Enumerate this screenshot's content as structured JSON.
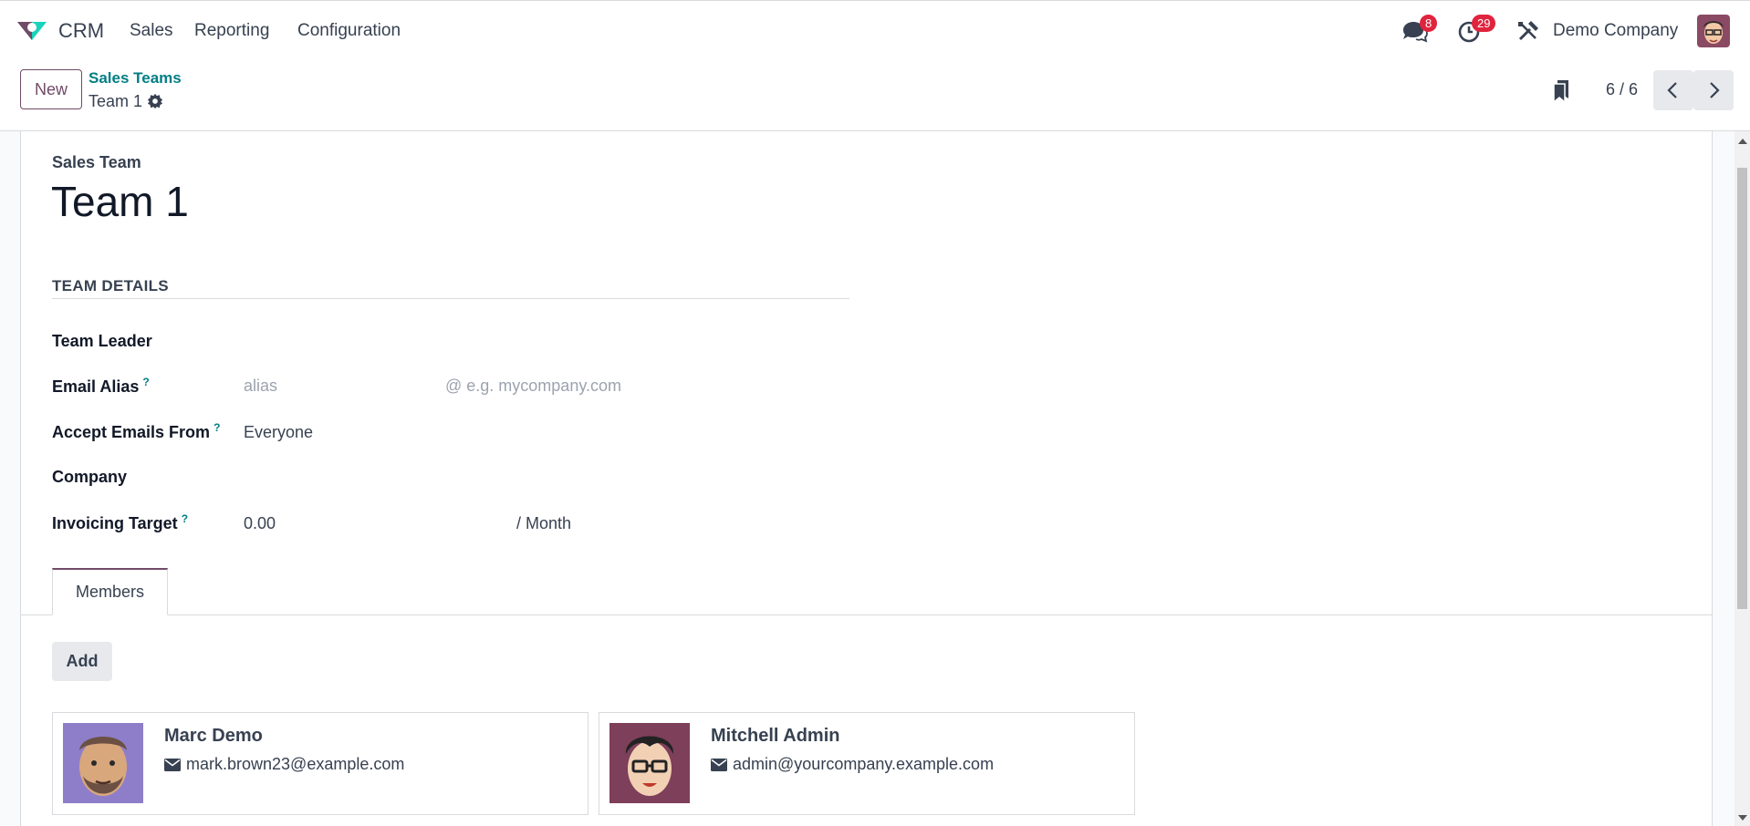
{
  "navbar": {
    "app_name": "CRM",
    "menu": [
      "Sales",
      "Reporting",
      "Configuration"
    ],
    "messages_count": "8",
    "activities_count": "29",
    "company": "Demo Company"
  },
  "control_panel": {
    "new_label": "New",
    "breadcrumb_parent": "Sales Teams",
    "breadcrumb_current": "Team 1",
    "pager": "6 / 6"
  },
  "form": {
    "record_label": "Sales Team",
    "record_name": "Team 1",
    "section_title": "TEAM DETAILS",
    "fields": {
      "team_leader_label": "Team Leader",
      "email_alias_label": "Email Alias",
      "email_alias_placeholder": "alias",
      "email_domain_placeholder": "@ e.g. mycompany.com",
      "accept_emails_label": "Accept Emails From",
      "accept_emails_value": "Everyone",
      "company_label": "Company",
      "invoicing_target_label": "Invoicing Target",
      "invoicing_target_value": "0.00",
      "invoicing_target_unit": "/ Month",
      "help_mark": "?"
    },
    "tabs": [
      "Members"
    ],
    "add_label": "Add",
    "members": [
      {
        "name": "Marc Demo",
        "email": "mark.brown23@example.com"
      },
      {
        "name": "Mitchell Admin",
        "email": "admin@yourcompany.example.com"
      }
    ]
  },
  "colors": {
    "brand": "#714b67",
    "link": "#017e84",
    "badge": "#e0243d"
  }
}
